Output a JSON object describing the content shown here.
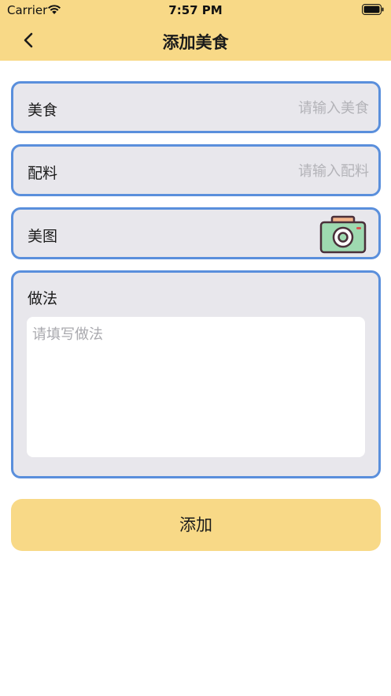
{
  "status_bar": {
    "carrier": "Carrier",
    "time": "7:57 PM",
    "wifi_icon": "wifi-icon",
    "battery_icon": "battery-icon"
  },
  "nav": {
    "title": "添加美食",
    "back_icon": "chevron-left-icon"
  },
  "form": {
    "food": {
      "label": "美食",
      "placeholder": "请输入美食",
      "value": ""
    },
    "ingredients": {
      "label": "配料",
      "placeholder": "请输入配料",
      "value": ""
    },
    "image": {
      "label": "美图",
      "icon": "camera-icon"
    },
    "method": {
      "label": "做法",
      "placeholder": "请填写做法",
      "value": ""
    }
  },
  "add_button": {
    "label": "添加"
  },
  "colors": {
    "header_bg": "#f8d987",
    "field_bg": "#e8e7ec",
    "field_border": "#5a8fdc",
    "button_bg": "#f8d987",
    "camera_body": "#9ed9b0",
    "camera_top": "#f3b48b",
    "camera_outline": "#4a2f3a"
  }
}
